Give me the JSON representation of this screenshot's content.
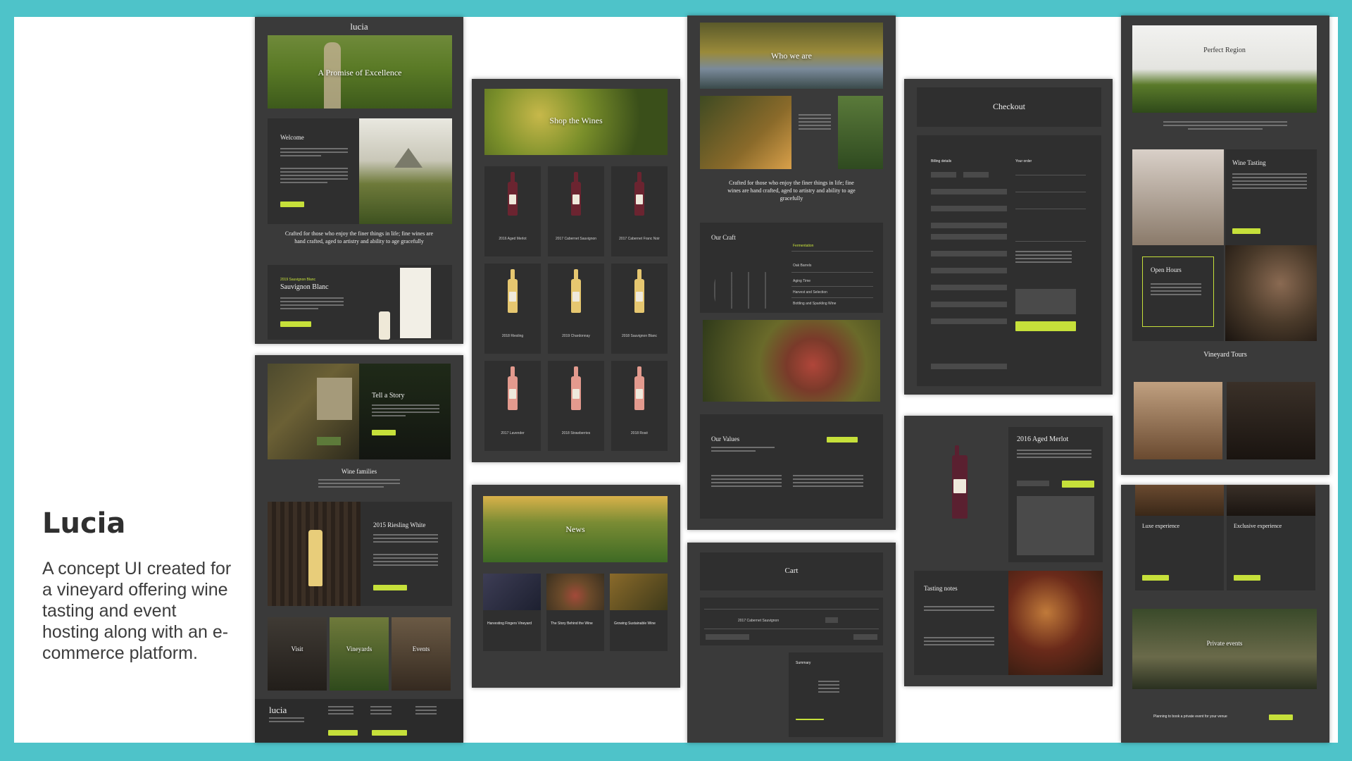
{
  "project": {
    "title": "Lucia",
    "description": "A concept UI created for a vineyard offering wine tasting and event hosting along with an e-commerce platform."
  },
  "colors": {
    "background": "#4ec3c9",
    "panel": "#3a3a3a",
    "card": "#2f2f2f",
    "accent": "#c6e03a"
  },
  "home": {
    "logo": "lucia",
    "hero": "A Promise of Excellence",
    "welcome": "Welcome",
    "crafted": "Crafted for those who enjoy the finer things in life; fine wines are hand crafted, aged to artistry and ability to age gracefully",
    "feature_label": "2019 Sauvignon Blanc",
    "feature_title": "Sauvignon Blanc"
  },
  "story": {
    "title": "Tell a Story",
    "families": "Wine families",
    "product_title": "2015 Riesling White",
    "tiles": [
      "Visit",
      "Vineyards",
      "Events"
    ],
    "footer_logo": "lucia"
  },
  "shop": {
    "title": "Shop the Wines",
    "wines": [
      "2016 Aged Merlot",
      "2017 Cabernet Sauvignon",
      "2017 Cabernet Franc Noir",
      "2018 Riesling",
      "2019 Chardonnay",
      "2018 Sauvignon Blanc",
      "2017 Lavender",
      "2018 Strawberries",
      "2018 Rosé"
    ]
  },
  "news": {
    "title": "News",
    "items": [
      "Harvesting Fingers Vineyard",
      "The Story Behind the Wine",
      "Growing Sustainable Wine"
    ]
  },
  "about": {
    "hero": "Who we are",
    "crafted": "Crafted for those who enjoy the finer things in life; fine wines are hand crafted, aged to artistry and ability to age gracefully",
    "craft": "Our Craft",
    "craft_items": [
      "Fermentation",
      "Oak Barrels",
      "Aging Time",
      "Harvest and Selection",
      "Bottling and Sparkling Wine"
    ],
    "values": "Our Values"
  },
  "cart": {
    "title": "Cart",
    "item": "2017 Cabernet Sauvignon",
    "summary": "Summary"
  },
  "checkout": {
    "title": "Checkout",
    "billing": "Billing details",
    "order": "Your order"
  },
  "product": {
    "title": "2016 Aged Merlot",
    "notes": "Tasting notes"
  },
  "experience": {
    "hero": "Perfect Region",
    "tasting": "Wine Tasting",
    "hours": "Open Hours",
    "tours": "Vineyard Tours",
    "lux1": "Luxe experience",
    "lux2": "Exclusive experience",
    "private": "Private events",
    "cta": "Planning to book a private event for your venue"
  }
}
